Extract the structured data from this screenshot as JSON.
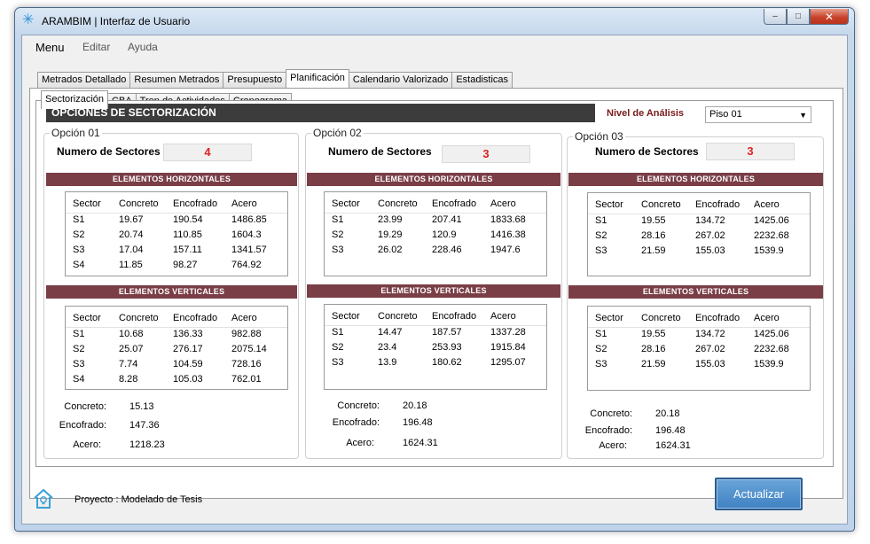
{
  "window": {
    "title": "ARAMBIM | Interfaz de Usuario",
    "controls": [
      "–",
      "□",
      "✕"
    ]
  },
  "menu": [
    "Menu",
    "Editar",
    "Ayuda"
  ],
  "main_tabs": [
    "Metrados Detallado",
    "Resumen Metrados",
    "Presupuesto",
    "Planificación",
    "Calendario Valorizado",
    "Estadisticas"
  ],
  "sub_tabs": [
    "Sectorización",
    "CBA",
    "Tren de Actividades",
    "Cronograma"
  ],
  "header": {
    "title": "OPCIONES DE SECTORIZACIÓN",
    "nivel_label": "Nivel de Análisis",
    "nivel_value": "Piso 01"
  },
  "options": [
    {
      "title": "Opción 01",
      "sectors_label": "Numero de Sectores",
      "sectors_value": "4",
      "horizontal_title": "ELEMENTOS HORIZONTALES",
      "vertical_title": "ELEMENTOS VERTICALES",
      "columns": [
        "Sector",
        "Concreto",
        "Encofrado",
        "Acero"
      ],
      "horizontal_rows": [
        [
          "S1",
          "19.67",
          "190.54",
          "1486.85"
        ],
        [
          "S2",
          "20.74",
          "110.85",
          "1604.3"
        ],
        [
          "S3",
          "17.04",
          "157.11",
          "1341.57"
        ],
        [
          "S4",
          "11.85",
          "98.27",
          "764.92"
        ]
      ],
      "vertical_rows": [
        [
          "S1",
          "10.68",
          "136.33",
          "982.88"
        ],
        [
          "S2",
          "25.07",
          "276.17",
          "2075.14"
        ],
        [
          "S3",
          "7.74",
          "104.59",
          "728.16"
        ],
        [
          "S4",
          "8.28",
          "105.03",
          "762.01"
        ]
      ],
      "summary": [
        {
          "label": "Concreto:",
          "value": "15.13"
        },
        {
          "label": "Encofrado:",
          "value": "147.36"
        },
        {
          "label": "Acero:",
          "value": "1218.23"
        }
      ]
    },
    {
      "title": "Opción 02",
      "sectors_label": "Numero de Sectores",
      "sectors_value": "3",
      "horizontal_title": "ELEMENTOS HORIZONTALES",
      "vertical_title": "ELEMENTOS VERTICALES",
      "columns": [
        "Sector",
        "Concreto",
        "Encofrado",
        "Acero"
      ],
      "horizontal_rows": [
        [
          "S1",
          "23.99",
          "207.41",
          "1833.68"
        ],
        [
          "S2",
          "19.29",
          "120.9",
          "1416.38"
        ],
        [
          "S3",
          "26.02",
          "228.46",
          "1947.6"
        ]
      ],
      "vertical_rows": [
        [
          "S1",
          "14.47",
          "187.57",
          "1337.28"
        ],
        [
          "S2",
          "23.4",
          "253.93",
          "1915.84"
        ],
        [
          "S3",
          "13.9",
          "180.62",
          "1295.07"
        ]
      ],
      "summary": [
        {
          "label": "Concreto:",
          "value": "20.18"
        },
        {
          "label": "Encofrado:",
          "value": "196.48"
        },
        {
          "label": "Acero:",
          "value": "1624.31"
        }
      ]
    },
    {
      "title": "Opción 03",
      "sectors_label": "Numero de Sectores",
      "sectors_value": "3",
      "horizontal_title": "ELEMENTOS HORIZONTALES",
      "vertical_title": "ELEMENTOS VERTICALES",
      "columns": [
        "Sector",
        "Concreto",
        "Encofrado",
        "Acero"
      ],
      "horizontal_rows": [
        [
          "S1",
          "19.55",
          "134.72",
          "1425.06"
        ],
        [
          "S2",
          "28.16",
          "267.02",
          "2232.68"
        ],
        [
          "S3",
          "21.59",
          "155.03",
          "1539.9"
        ]
      ],
      "vertical_rows": [
        [
          "S1",
          "19.55",
          "134.72",
          "1425.06"
        ],
        [
          "S2",
          "28.16",
          "267.02",
          "2232.68"
        ],
        [
          "S3",
          "21.59",
          "155.03",
          "1539.9"
        ]
      ],
      "summary": [
        {
          "label": "Concreto:",
          "value": "20.18"
        },
        {
          "label": "Encofrado:",
          "value": "196.48"
        },
        {
          "label": "Acero:",
          "value": "1624.31"
        }
      ]
    }
  ],
  "footer": {
    "project_text": "Proyecto : Modelado de Tesis",
    "button_label": "Actualizar",
    "home_icon": "house-lightbulb-icon"
  },
  "colors": {
    "section_bar": "#7a3e46",
    "header_bar": "#3c3c3c",
    "sector_count": "#e02020",
    "nivel_label": "#7a1a1a",
    "button": "#4a8bcb"
  }
}
